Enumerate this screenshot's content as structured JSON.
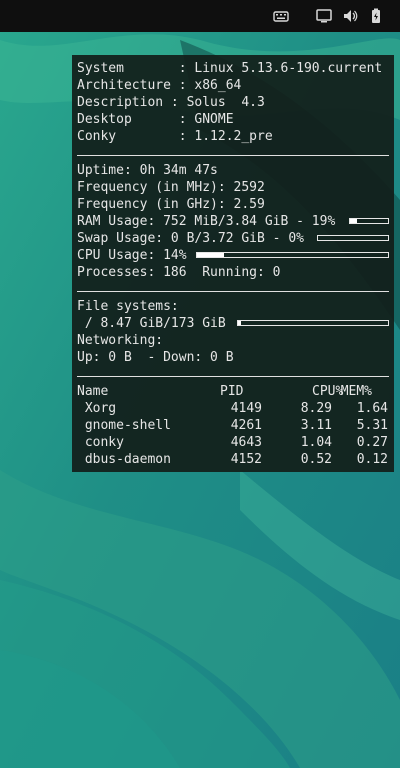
{
  "colors": {
    "panel_bg": "#0f0f0f",
    "wallpaper_teal": "#1e8f8a",
    "wallpaper_dark": "#0d3c3a",
    "conky_text": "#e6e6e6"
  },
  "tray": [
    "keyboard-icon",
    "display-icon",
    "volume-icon",
    "battery-icon"
  ],
  "system": {
    "lines": [
      "System       : Linux 5.13.6-190.current",
      "Architecture : x86_64",
      "Description : Solus  4.3",
      "Desktop      : GNOME",
      "Conky        : 1.12.2_pre"
    ]
  },
  "stats": {
    "uptime": "Uptime: 0h 34m 47s",
    "freq_mhz": "Frequency (in MHz): 2592",
    "freq_ghz": "Frequency (in GHz): 2.59",
    "ram": "RAM Usage: 752 MiB/3.84 GiB - 19%",
    "ram_pct": 19,
    "swap": "Swap Usage: 0 B/3.72 GiB - 0%",
    "swap_pct": 0,
    "cpu": "CPU Usage: 14%",
    "cpu_pct": 14,
    "processes": "Processes: 186  Running: 0"
  },
  "fs": {
    "header": "File systems:",
    "root": " / 8.47 GiB/173 GiB",
    "root_pct": 2,
    "networking": "Networking:",
    "updown": "Up: 0 B  - Down: 0 B"
  },
  "procs": {
    "headers": {
      "name": "Name",
      "pid": "PID",
      "cpu": "CPU%",
      "mem": "MEM%"
    },
    "rows": [
      {
        "name": " Xorg",
        "pid": "4149",
        "cpu": "8.29",
        "mem": "1.64"
      },
      {
        "name": " gnome-shell",
        "pid": "4261",
        "cpu": "3.11",
        "mem": "5.31"
      },
      {
        "name": " conky",
        "pid": "4643",
        "cpu": "1.04",
        "mem": "0.27"
      },
      {
        "name": " dbus-daemon",
        "pid": "4152",
        "cpu": "0.52",
        "mem": "0.12"
      }
    ]
  }
}
